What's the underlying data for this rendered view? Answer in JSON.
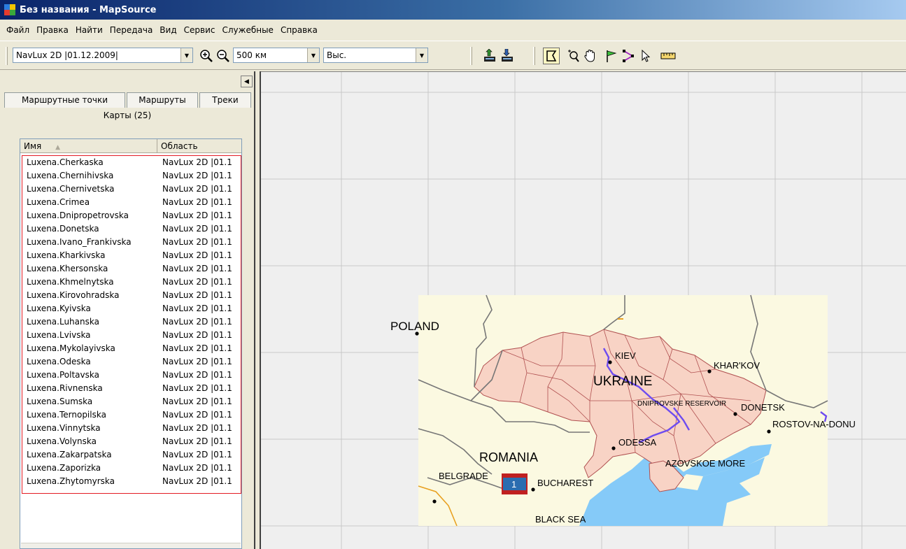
{
  "window": {
    "title": "Без названия - MapSource"
  },
  "menu": [
    "Файл",
    "Правка",
    "Найти",
    "Передача",
    "Вид",
    "Сервис",
    "Служебные",
    "Справка"
  ],
  "toolbar": {
    "map_product": "NavLux 2D |01.12.2009|",
    "zoom_level": "500 км",
    "detail": "Выс.",
    "icons": [
      "zoom-in-icon",
      "zoom-out-icon",
      "receive-from-device-icon",
      "send-to-device-icon",
      "map-select-tool-icon",
      "zoom-tool-icon",
      "pan-hand-icon",
      "waypoint-flag-icon",
      "route-tool-icon",
      "pointer-tool-icon",
      "measure-ruler-icon"
    ]
  },
  "panel": {
    "tabs": [
      "Маршрутные точки",
      "Маршруты",
      "Треки"
    ],
    "active_tab": "Карты (25)",
    "columns": [
      "Имя",
      "Область"
    ],
    "rows": [
      {
        "name": "Luxena.Cherkaska",
        "area": "NavLux 2D |01.1"
      },
      {
        "name": "Luxena.Chernihivska",
        "area": "NavLux 2D |01.1"
      },
      {
        "name": "Luxena.Chernivetska",
        "area": "NavLux 2D |01.1"
      },
      {
        "name": "Luxena.Crimea",
        "area": "NavLux 2D |01.1"
      },
      {
        "name": "Luxena.Dnipropetrovska",
        "area": "NavLux 2D |01.1"
      },
      {
        "name": "Luxena.Donetska",
        "area": "NavLux 2D |01.1"
      },
      {
        "name": "Luxena.Ivano_Frankivska",
        "area": "NavLux 2D |01.1"
      },
      {
        "name": "Luxena.Kharkivska",
        "area": "NavLux 2D |01.1"
      },
      {
        "name": "Luxena.Khersonska",
        "area": "NavLux 2D |01.1"
      },
      {
        "name": "Luxena.Khmelnytska",
        "area": "NavLux 2D |01.1"
      },
      {
        "name": "Luxena.Kirovohradska",
        "area": "NavLux 2D |01.1"
      },
      {
        "name": "Luxena.Kyivska",
        "area": "NavLux 2D |01.1"
      },
      {
        "name": "Luxena.Luhanska",
        "area": "NavLux 2D |01.1"
      },
      {
        "name": "Luxena.Lvivska",
        "area": "NavLux 2D |01.1"
      },
      {
        "name": "Luxena.Mykolayivska",
        "area": "NavLux 2D |01.1"
      },
      {
        "name": "Luxena.Odeska",
        "area": "NavLux 2D |01.1"
      },
      {
        "name": "Luxena.Poltavska",
        "area": "NavLux 2D |01.1"
      },
      {
        "name": "Luxena.Rivnenska",
        "area": "NavLux 2D |01.1"
      },
      {
        "name": "Luxena.Sumska",
        "area": "NavLux 2D |01.1"
      },
      {
        "name": "Luxena.Ternopilska",
        "area": "NavLux 2D |01.1"
      },
      {
        "name": "Luxena.Vinnytska",
        "area": "NavLux 2D |01.1"
      },
      {
        "name": "Luxena.Volynska",
        "area": "NavLux 2D |01.1"
      },
      {
        "name": "Luxena.Zakarpatska",
        "area": "NavLux 2D |01.1"
      },
      {
        "name": "Luxena.Zaporizka",
        "area": "NavLux 2D |01.1"
      },
      {
        "name": "Luxena.Zhytomyrska",
        "area": "NavLux 2D |01.1"
      }
    ]
  },
  "map": {
    "labels": {
      "poland": "POLAND",
      "kiev": "KIEV",
      "kharkov": "KHAR'KOV",
      "ukraine": "UKRAINE",
      "dniprovske": "DNIPROVSKE RESERVOIR",
      "donetsk": "DONETSK",
      "rostov": "ROSTOV-NA-DONU",
      "odessa": "ODESSA",
      "romania": "ROMANIA",
      "azov": "AZOVSKOE MORE",
      "belgrade": "BELGRADE",
      "bucharest": "BUCHAREST",
      "black_sea": "BLACK SEA"
    },
    "marker": "1",
    "colors": {
      "land": "#fbf9e1",
      "country": "#f8d3c5",
      "water": "#85caf8",
      "border": "#b05050",
      "grid": "#c8c8c8",
      "background": "#efefef"
    }
  }
}
